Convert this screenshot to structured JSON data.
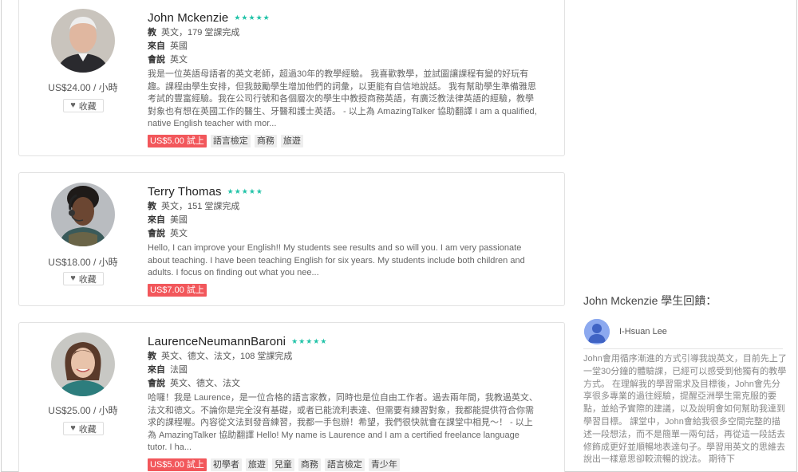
{
  "teachers": [
    {
      "name": "John Mckenzie",
      "stars": "★★★★★",
      "teaches_label": "教",
      "teaches_value": "英文，179 堂課完成",
      "from_label": "來自",
      "from_value": "英國",
      "speaks_label": "會說",
      "speaks_value": "英文",
      "description": "我是一位英語母語者的英文老師，超過30年的教學經驗。 我喜歡教學，並試圖讓課程有變的好玩有趣。課程由學生安排，但我鼓勵學生增加他們的詞彙，以更能有自信地說話。 我有幫助學生準備雅思考試的豐富經驗。我在公司行號和各個層次的學生中教授商務英語，有廣泛教法律英語的經驗，教學對象也有想在英國工作的醫生、牙醫和護士英語。 - 以上為 AmazingTalker 協助翻譯 I am a qualified, native English teacher with mor...",
      "price": "US$24.00 / 小時",
      "favorite_label": "收藏",
      "trial": "US$5.00 試上",
      "tags": [
        "語言檢定",
        "商務",
        "旅遊"
      ]
    },
    {
      "name": "Terry Thomas",
      "stars": "★★★★★",
      "teaches_label": "教",
      "teaches_value": "英文，151 堂課完成",
      "from_label": "來自",
      "from_value": "美國",
      "speaks_label": "會說",
      "speaks_value": "英文",
      "description": "Hello, I can improve your English!! My students see results and so will you. I am very passionate about teaching. I have been teaching English for six years. My students include both children and adults. I focus on finding out what you nee...",
      "price": "US$18.00 / 小時",
      "favorite_label": "收藏",
      "trial": "US$7.00 試上",
      "tags": []
    },
    {
      "name": "LaurenceNeumannBaroni",
      "stars": "★★★★★",
      "teaches_label": "教",
      "teaches_value": "英文、德文、法文，108 堂課完成",
      "from_label": "來自",
      "from_value": "法國",
      "speaks_label": "會說",
      "speaks_value": "英文、德文、法文",
      "description": "哈囉！我是 Laurence，是一位合格的語言家教，同時也是位自由工作者。過去兩年間，我教過英文、法文和德文。不論你是完全沒有基礎，或者已能流利表達、但需要有練習對象，我都能提供符合你需求的課程喔。內容從文法到發音練習，我都一手包辦！希望，我們很快就會在課堂中相見～！ - 以上為 AmazingTalker 協助翻譯 Hello! My name is Laurence and I am a certified freelance language tutor. I ha...",
      "price": "US$25.00 / 小時",
      "favorite_label": "收藏",
      "trial": "US$5.00 試上",
      "tags": [
        "初學者",
        "旅遊",
        "兒童",
        "商務",
        "語言檢定",
        "青少年"
      ]
    }
  ],
  "review": {
    "title": "John Mckenzie 學生回饋：",
    "reviewer": "I-Hsuan Lee",
    "text": "John會用循序漸進的方式引導我說英文，目前先上了一堂30分鐘的體驗課，已經可以感受到他獨有的教學方式。 在理解我的學習需求及目標後，John會先分享很多專業的過往經驗，提醒亞洲學生需克服的要點，並給予實際的建議，以及說明會如何幫助我達到學習目標。 課堂中，John會給我很多空間完整的描述一段想法，而不是簡單一兩句話，再從這一段話去修飾成更好並順暢地表達句子。學習用英文的思維去說出一樣意思卻較流暢的說法。 期待下"
  }
}
